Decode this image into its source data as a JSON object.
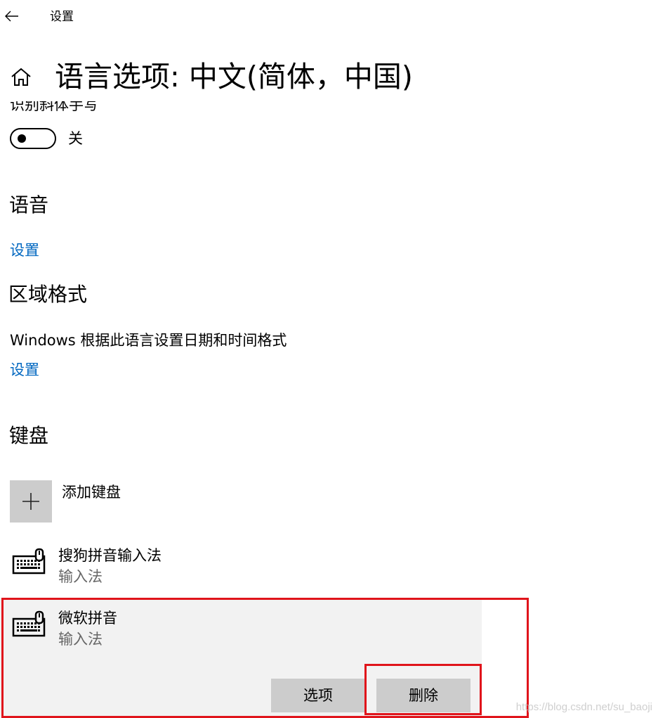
{
  "titlebar": {
    "back_icon": "arrow-left-icon",
    "app_title": "设置"
  },
  "header": {
    "home_icon": "home-icon",
    "title": "语言选项: 中文(简体，中国)"
  },
  "handwriting": {
    "clipped_label": "识别斜体手写",
    "toggle_on": false,
    "toggle_state_label": "关"
  },
  "speech": {
    "heading": "语音",
    "settings_link": "设置"
  },
  "region": {
    "heading": "区域格式",
    "description": "Windows 根据此语言设置日期和时间格式",
    "settings_link": "设置"
  },
  "keyboards": {
    "heading": "键盘",
    "add_label": "添加键盘",
    "add_icon": "plus-icon",
    "items": [
      {
        "name": "搜狗拼音输入法",
        "type": "输入法",
        "icon": "keyboard-icon"
      },
      {
        "name": "微软拼音",
        "type": "输入法",
        "icon": "keyboard-icon",
        "selected": true
      }
    ],
    "options_button": "选项",
    "remove_button": "删除"
  },
  "annotation": {
    "highlight_color": "#e0141b"
  },
  "watermark": "https://blog.csdn.net/su_baoji",
  "colors": {
    "link": "#0067c0",
    "selected_background": "#f2f2f2",
    "button_background": "#cccccc",
    "secondary_text": "#666666"
  }
}
